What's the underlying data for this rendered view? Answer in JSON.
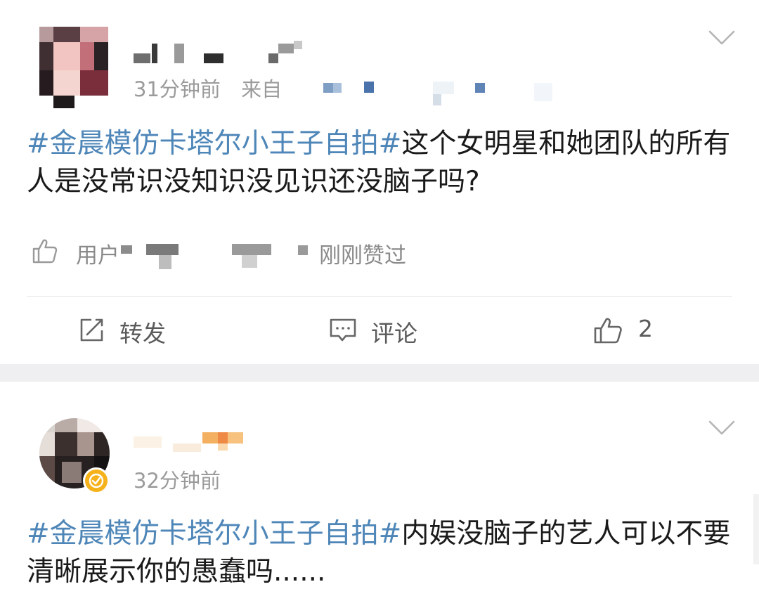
{
  "posts": [
    {
      "time": "31分钟前",
      "source_prefix": "来自",
      "hashtag": "#金晨模仿卡塔尔小王子自拍#",
      "text": "这个女明星和她团队的所有人是没常识没知识没见识还没脑子吗?",
      "likes_prefix": "用户",
      "likes_suffix": "刚刚赞过",
      "actions": {
        "repost_label": "转发",
        "comment_label": "评论",
        "like_count": "2"
      }
    },
    {
      "time": "32分钟前",
      "hashtag": "#金晨模仿卡塔尔小王子自拍#",
      "text": "内娱没脑子的艺人可以不要清晰展示你的愚蠢吗......"
    }
  ],
  "colors": {
    "hashtag": "#4e86b8",
    "meta": "#9b9b9b",
    "separator": "#efeff1",
    "verified_badge": "#f6b21a"
  },
  "icons": {
    "chevron": "chevron-down-icon",
    "like": "thumbs-up-icon",
    "repost": "repost-icon",
    "comment": "comment-icon",
    "verified": "verified-badge-icon"
  }
}
